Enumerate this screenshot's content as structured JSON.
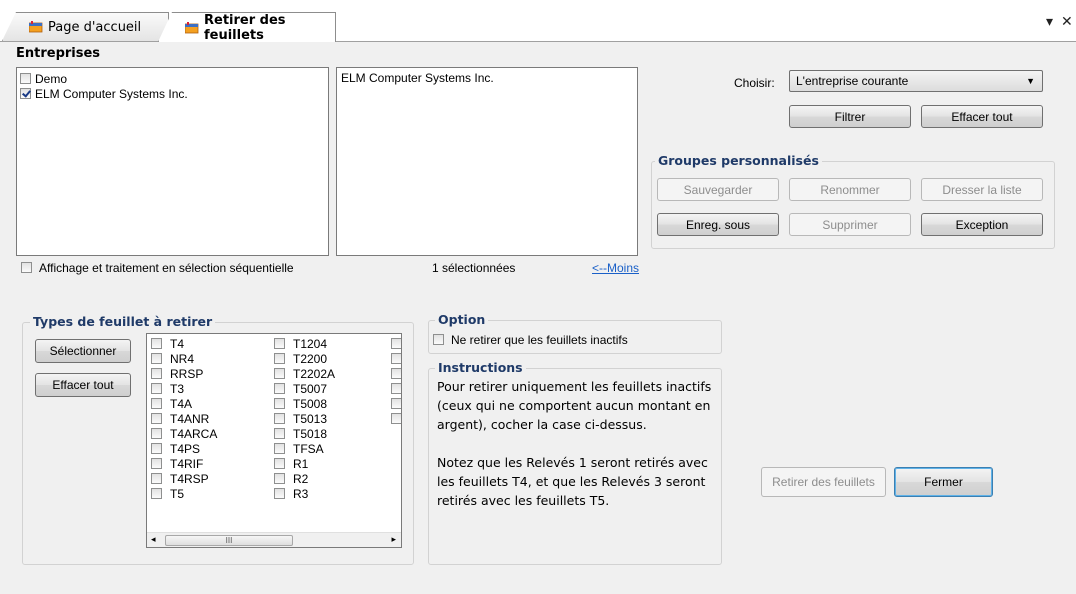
{
  "tabs": [
    {
      "label": "Page d'accueil"
    },
    {
      "label": "Retirer des feuillets"
    }
  ],
  "window_controls": {
    "dropdown": "▾",
    "close": "✕"
  },
  "entreprises": {
    "heading": "Entreprises",
    "items": [
      {
        "label": "Demo",
        "checked": false
      },
      {
        "label": "ELM Computer Systems Inc.",
        "checked": true
      }
    ],
    "selected_list": [
      "ELM Computer Systems Inc."
    ],
    "sequential_label": "Affichage et traitement en sélection séquentielle",
    "selected_count": "1 sélectionnées",
    "less_link": "<--Moins"
  },
  "filter": {
    "choose_label": "Choisir:",
    "choose_value": "L'entreprise courante",
    "filter_button": "Filtrer",
    "clear_all_button": "Effacer tout"
  },
  "groupes": {
    "title": "Groupes personnalisés",
    "save": "Sauvegarder",
    "rename": "Renommer",
    "list": "Dresser la liste",
    "save_as": "Enreg. sous",
    "delete": "Supprimer",
    "exception": "Exception"
  },
  "types": {
    "title": "Types de feuillet à retirer",
    "select_button": "Sélectionner",
    "clear_button": "Effacer tout",
    "col1": [
      "T4",
      "NR4",
      "RRSP",
      "T3",
      "T4A",
      "T4ANR",
      "T4ARCA",
      "T4PS",
      "T4RIF",
      "T4RSP",
      "T5"
    ],
    "col2": [
      "T1204",
      "T2200",
      "T2202A",
      "T5007",
      "T5008",
      "T5013",
      "T5018",
      "TFSA",
      "R1",
      "R2",
      "R3"
    ],
    "scroll_thumb": "III"
  },
  "option": {
    "title": "Option",
    "inactive_label": "Ne retirer que les feuillets inactifs"
  },
  "instructions": {
    "title": "Instructions",
    "para1": "Pour retirer uniquement les feuillets inactifs (ceux qui ne comportent aucun montant en argent), cocher la case ci-dessus.",
    "para2": "Notez que les Relevés 1 seront retirés avec les feuillets T4, et que les Relevés 3 seront retirés avec les feuillets T5."
  },
  "actions": {
    "remove": "Retirer des feuillets",
    "close": "Fermer"
  }
}
